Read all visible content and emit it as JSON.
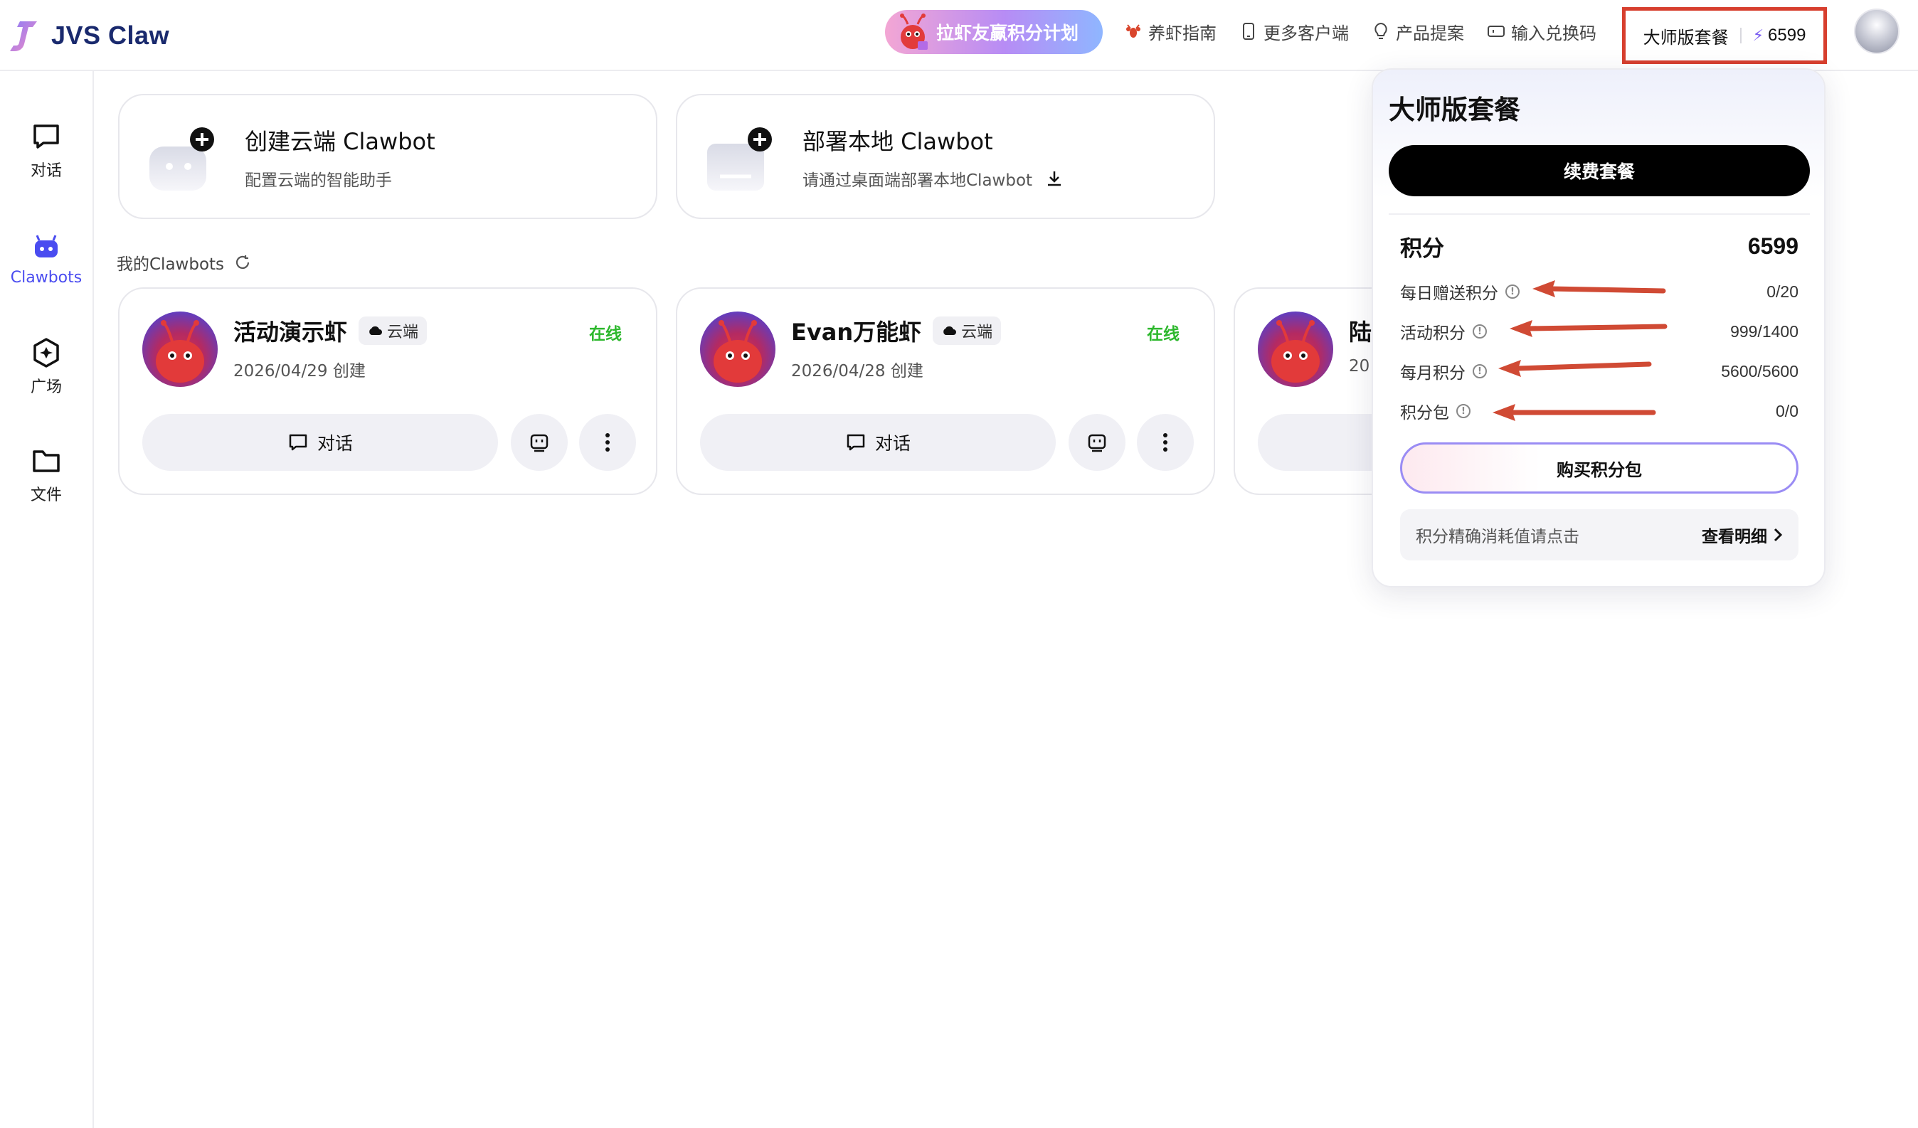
{
  "app": {
    "name": "JVS Claw"
  },
  "header": {
    "promo_label": "拉虾友赢积分计划",
    "links": [
      {
        "label": "养虾指南",
        "icon": "lobster-icon"
      },
      {
        "label": "更多客户端",
        "icon": "phone-icon"
      },
      {
        "label": "产品提案",
        "icon": "lightbulb-icon"
      },
      {
        "label": "输入兑换码",
        "icon": "ticket-icon"
      }
    ],
    "plan_name": "大师版套餐",
    "points": "6599"
  },
  "sidebar": {
    "items": [
      {
        "label": "对话",
        "icon": "chat-icon",
        "active": false
      },
      {
        "label": "Clawbots",
        "icon": "robot-icon",
        "active": true
      },
      {
        "label": "广场",
        "icon": "plaza-icon",
        "active": false
      },
      {
        "label": "文件",
        "icon": "folder-icon",
        "active": false
      }
    ]
  },
  "create_cards": [
    {
      "title": "创建云端 Clawbot",
      "subtitle": "配置云端的智能助手"
    },
    {
      "title": "部署本地 Clawbot",
      "subtitle": "请通过桌面端部署本地Clawbot"
    }
  ],
  "section_title": "我的Clawbots",
  "bots": [
    {
      "name": "活动演示虾",
      "tag": "云端",
      "status": "在线",
      "date": "2026/04/29 创建",
      "chat_label": "对话"
    },
    {
      "name": "Evan万能虾",
      "tag": "云端",
      "status": "在线",
      "date": "2026/04/28 创建",
      "chat_label": "对话"
    },
    {
      "name": "陆",
      "date": "20"
    }
  ],
  "popover": {
    "title": "大师版套餐",
    "renew_label": "续费套餐",
    "points_label": "积分",
    "points_total": "6599",
    "rows": [
      {
        "label": "每日赠送积分",
        "value": "0/20"
      },
      {
        "label": "活动积分",
        "value": "999/1400"
      },
      {
        "label": "每月积分",
        "value": "5600/5600"
      },
      {
        "label": "积分包",
        "value": "0/0"
      }
    ],
    "buy_label": "购买积分包",
    "detail_text": "积分精确消耗值请点击",
    "detail_link": "查看明细"
  },
  "colors": {
    "accent": "#4a4cf0",
    "highlight_box": "#d73f2e",
    "online": "#2eb82e",
    "arrow": "#d04a34"
  }
}
